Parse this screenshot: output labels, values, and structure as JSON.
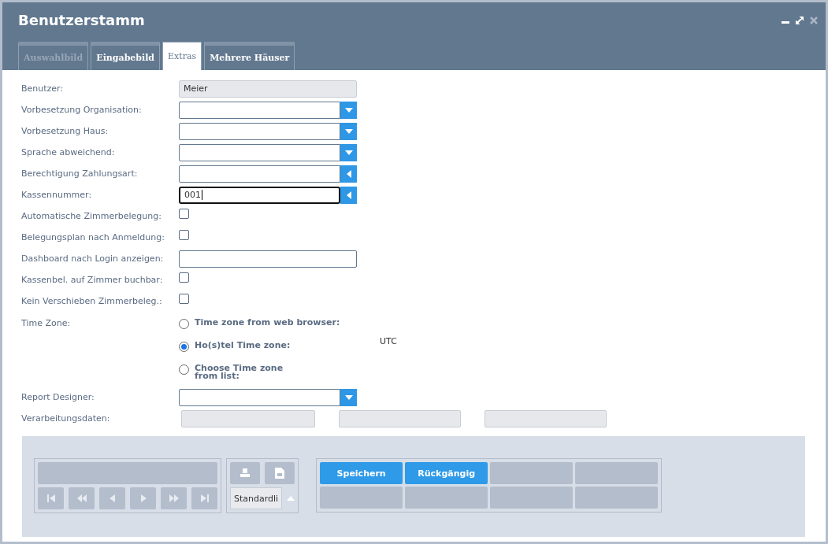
{
  "window": {
    "title": "Benutzerstamm"
  },
  "tabs": [
    {
      "label": "Auswahlbild",
      "selected": false,
      "disabled": true
    },
    {
      "label": "Eingabebild",
      "selected": false,
      "disabled": false
    },
    {
      "label": "Extras",
      "selected": true,
      "disabled": false
    },
    {
      "label": "Mehrere Häuser",
      "selected": false,
      "disabled": false
    }
  ],
  "form": {
    "rows": [
      {
        "kind": "readonly",
        "label": "Benutzer:",
        "value": "Meier"
      },
      {
        "kind": "select",
        "label": "Vorbesetzung Organisation:"
      },
      {
        "kind": "select",
        "label": "Vorbesetzung Haus:"
      },
      {
        "kind": "select",
        "label": "Sprache abweichend:"
      },
      {
        "kind": "lookup",
        "label": "Berechtigung Zahlungsart:",
        "focused": false
      },
      {
        "kind": "lookup",
        "label": "Kassennummer:",
        "value": "001",
        "focused": true
      },
      {
        "kind": "checkbox",
        "label": "Automatische Zimmerbelegung:",
        "checked": false
      },
      {
        "kind": "checkbox",
        "label": "Belegungsplan nach Anmeldung:",
        "checked": false
      },
      {
        "kind": "text",
        "label": "Dashboard nach Login anzeigen:"
      },
      {
        "kind": "checkbox",
        "label": "Kassenbel. auf Zimmer buchbar:",
        "checked": false
      },
      {
        "kind": "checkbox",
        "label": "Kein Verschieben Zimmerbeleg.:",
        "checked": false
      }
    ],
    "time_zone": {
      "label": "Time Zone:",
      "options": [
        {
          "label": "Time zone from web browser:",
          "selected": false
        },
        {
          "label": "Ho(s)tel Time zone:",
          "selected": true,
          "value": "UTC"
        },
        {
          "label": "Choose Time zone\nfrom list:",
          "selected": false
        }
      ]
    },
    "report_designer": {
      "label": "Report Designer:"
    },
    "processing_data": {
      "label": "Verarbeitungsdaten:"
    }
  },
  "toolbar": {
    "print_layout": "Standardli",
    "actions": [
      "Speichern",
      "Rückgängig"
    ]
  }
}
